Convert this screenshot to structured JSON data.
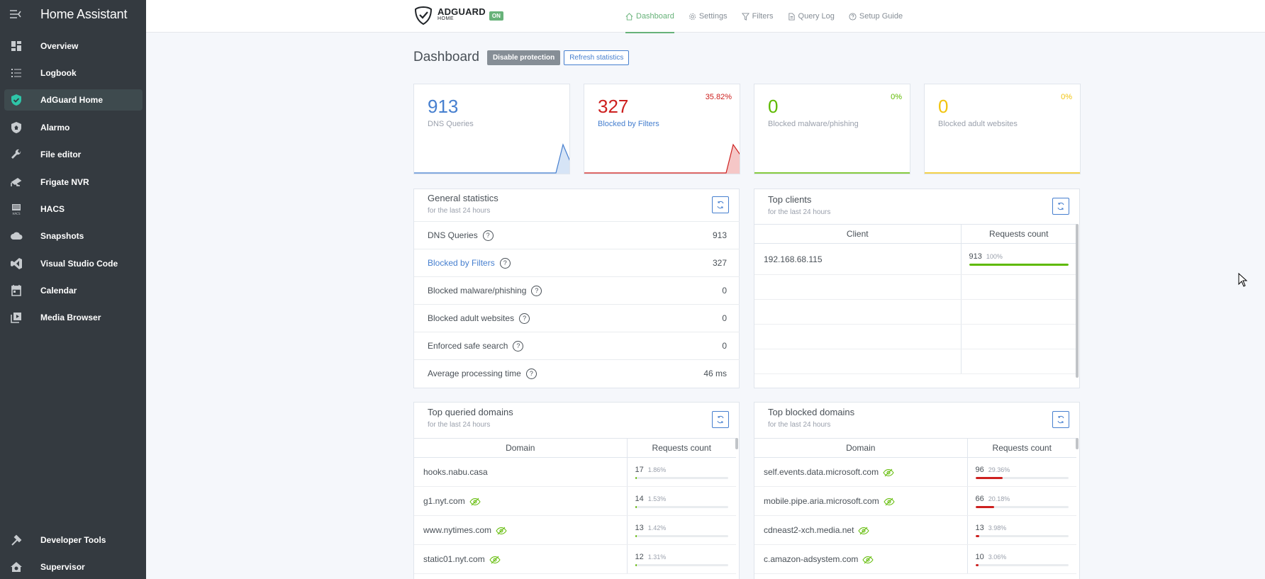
{
  "sidebar": {
    "title": "Home Assistant",
    "items": [
      {
        "label": "Overview",
        "icon": "dashboard-icon"
      },
      {
        "label": "Logbook",
        "icon": "list-icon"
      },
      {
        "label": "AdGuard Home",
        "icon": "shield-check-icon",
        "active": true
      },
      {
        "label": "Alarmo",
        "icon": "shield-home-icon"
      },
      {
        "label": "File editor",
        "icon": "wrench-icon"
      },
      {
        "label": "Frigate NVR",
        "icon": "cctv-icon"
      },
      {
        "label": "HACS",
        "icon": "hacs-icon"
      },
      {
        "label": "Snapshots",
        "icon": "cloud-icon"
      },
      {
        "label": "Visual Studio Code",
        "icon": "vscode-icon"
      },
      {
        "label": "Calendar",
        "icon": "calendar-icon"
      },
      {
        "label": "Media Browser",
        "icon": "play-box-icon"
      }
    ],
    "bottom_items": [
      {
        "label": "Developer Tools",
        "icon": "hammer-icon"
      },
      {
        "label": "Supervisor",
        "icon": "home-gear-icon"
      }
    ]
  },
  "brand": {
    "name": "ADGUARD",
    "sub": "HOME",
    "status": "ON"
  },
  "nav": [
    {
      "label": "Dashboard",
      "icon": "home-icon",
      "active": true
    },
    {
      "label": "Settings",
      "icon": "settings-icon"
    },
    {
      "label": "Filters",
      "icon": "filter-icon"
    },
    {
      "label": "Query Log",
      "icon": "file-icon"
    },
    {
      "label": "Setup Guide",
      "icon": "help-icon"
    }
  ],
  "page": {
    "title": "Dashboard",
    "disable_btn": "Disable protection",
    "refresh_btn": "Refresh statistics"
  },
  "stats": [
    {
      "value": "913",
      "label": "DNS Queries",
      "percent": "",
      "color": "#467fcf"
    },
    {
      "value": "327",
      "label": "Blocked by Filters",
      "percent": "35.82%",
      "color": "#cd201f"
    },
    {
      "value": "0",
      "label": "Blocked malware/phishing",
      "percent": "0%",
      "color": "#5eba00"
    },
    {
      "value": "0",
      "label": "Blocked adult websites",
      "percent": "0%",
      "color": "#f1c40f"
    }
  ],
  "general": {
    "title": "General statistics",
    "subtitle": "for the last 24 hours",
    "rows": [
      {
        "label": "DNS Queries",
        "value": "913"
      },
      {
        "label": "Blocked by Filters",
        "value": "327",
        "link": true
      },
      {
        "label": "Blocked malware/phishing",
        "value": "0"
      },
      {
        "label": "Blocked adult websites",
        "value": "0"
      },
      {
        "label": "Enforced safe search",
        "value": "0"
      },
      {
        "label": "Average processing time",
        "value": "46 ms"
      }
    ]
  },
  "top_clients": {
    "title": "Top clients",
    "subtitle": "for the last 24 hours",
    "col_client": "Client",
    "col_requests": "Requests count",
    "rows": [
      {
        "client": "192.168.68.115",
        "count": "913",
        "percent": "100%",
        "fraction": 1.0
      }
    ]
  },
  "top_queried": {
    "title": "Top queried domains",
    "subtitle": "for the last 24 hours",
    "col_domain": "Domain",
    "col_requests": "Requests count",
    "rows": [
      {
        "domain": "hooks.nabu.casa",
        "eye": false,
        "count": "17",
        "percent": "1.86%",
        "fraction": 0.0186
      },
      {
        "domain": "g1.nyt.com",
        "eye": true,
        "count": "14",
        "percent": "1.53%",
        "fraction": 0.0153
      },
      {
        "domain": "www.nytimes.com",
        "eye": true,
        "count": "13",
        "percent": "1.42%",
        "fraction": 0.0142
      },
      {
        "domain": "static01.nyt.com",
        "eye": true,
        "count": "12",
        "percent": "1.31%",
        "fraction": 0.0131
      }
    ]
  },
  "top_blocked": {
    "title": "Top blocked domains",
    "subtitle": "for the last 24 hours",
    "col_domain": "Domain",
    "col_requests": "Requests count",
    "rows": [
      {
        "domain": "self.events.data.microsoft.com",
        "count": "96",
        "percent": "29.36%",
        "fraction": 0.2936
      },
      {
        "domain": "mobile.pipe.aria.microsoft.com",
        "count": "66",
        "percent": "20.18%",
        "fraction": 0.2018
      },
      {
        "domain": "cdneast2-xch.media.net",
        "count": "13",
        "percent": "3.98%",
        "fraction": 0.0398
      },
      {
        "domain": "c.amazon-adsystem.com",
        "count": "10",
        "percent": "3.06%",
        "fraction": 0.0306
      }
    ]
  },
  "colors": {
    "green": "#5eba00",
    "red": "#cd201f",
    "blue": "#467fcf",
    "sidebar_bg": "#343a40"
  }
}
